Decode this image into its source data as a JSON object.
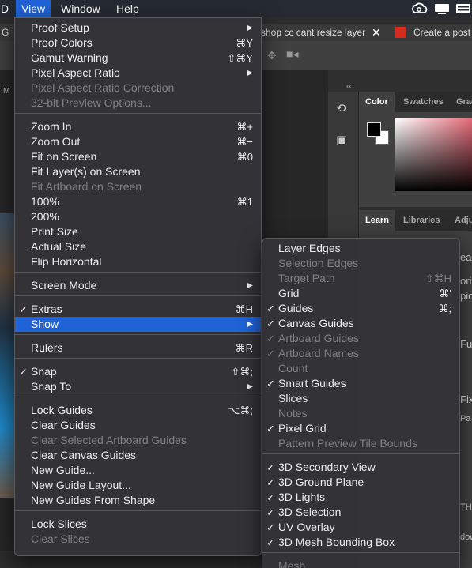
{
  "menubar": {
    "items": [
      {
        "label": "D"
      },
      {
        "label": "View"
      },
      {
        "label": "Window"
      },
      {
        "label": "Help"
      }
    ],
    "tray_icons": [
      "creative-cloud-icon",
      "screen-icon",
      "list-icon",
      "menu-icon"
    ]
  },
  "browser_tabs": [
    {
      "label": "G"
    },
    {
      "label": "shop cc cant resize layer"
    },
    {
      "label": "Create a post"
    }
  ],
  "side_panel": {
    "collapse_glyph": "‹‹",
    "top_tabs": [
      "Color",
      "Swatches",
      "Grad"
    ],
    "lower_tabs": [
      "Learn",
      "Libraries",
      "Adju"
    ],
    "right_fragments": [
      "ea",
      "ori",
      "pic",
      "Fu",
      "Fix",
      "Pa",
      "TH",
      "dow"
    ]
  },
  "doc_fragments": {
    "left_letters": [
      "M"
    ]
  },
  "view_menu": {
    "items": [
      {
        "type": "item",
        "label": "Proof Setup",
        "submenu": true
      },
      {
        "type": "item",
        "label": "Proof Colors",
        "shortcut": "⌘Y"
      },
      {
        "type": "item",
        "label": "Gamut Warning",
        "shortcut": "⇧⌘Y"
      },
      {
        "type": "item",
        "label": "Pixel Aspect Ratio",
        "submenu": true
      },
      {
        "type": "item",
        "label": "Pixel Aspect Ratio Correction",
        "disabled": true
      },
      {
        "type": "item",
        "label": "32-bit Preview Options...",
        "disabled": true
      },
      {
        "type": "separator"
      },
      {
        "type": "item",
        "label": "Zoom In",
        "shortcut": "⌘+"
      },
      {
        "type": "item",
        "label": "Zoom Out",
        "shortcut": "⌘−"
      },
      {
        "type": "item",
        "label": "Fit on Screen",
        "shortcut": "⌘0"
      },
      {
        "type": "item",
        "label": "Fit Layer(s) on Screen"
      },
      {
        "type": "item",
        "label": "Fit Artboard on Screen",
        "disabled": true
      },
      {
        "type": "item",
        "label": "100%",
        "shortcut": "⌘1"
      },
      {
        "type": "item",
        "label": "200%"
      },
      {
        "type": "item",
        "label": "Print Size"
      },
      {
        "type": "item",
        "label": "Actual Size"
      },
      {
        "type": "item",
        "label": "Flip Horizontal"
      },
      {
        "type": "separator"
      },
      {
        "type": "item",
        "label": "Screen Mode",
        "submenu": true
      },
      {
        "type": "separator"
      },
      {
        "type": "item",
        "label": "Extras",
        "shortcut": "⌘H",
        "checked": true
      },
      {
        "type": "item",
        "label": "Show",
        "submenu": true,
        "highlighted": true
      },
      {
        "type": "separator"
      },
      {
        "type": "item",
        "label": "Rulers",
        "shortcut": "⌘R"
      },
      {
        "type": "separator"
      },
      {
        "type": "item",
        "label": "Snap",
        "shortcut": "⇧⌘;",
        "checked": true
      },
      {
        "type": "item",
        "label": "Snap To",
        "submenu": true
      },
      {
        "type": "separator"
      },
      {
        "type": "item",
        "label": "Lock Guides",
        "shortcut": "⌥⌘;"
      },
      {
        "type": "item",
        "label": "Clear Guides"
      },
      {
        "type": "item",
        "label": "Clear Selected Artboard Guides",
        "disabled": true
      },
      {
        "type": "item",
        "label": "Clear Canvas Guides"
      },
      {
        "type": "item",
        "label": "New Guide..."
      },
      {
        "type": "item",
        "label": "New Guide Layout..."
      },
      {
        "type": "item",
        "label": "New Guides From Shape"
      },
      {
        "type": "separator"
      },
      {
        "type": "item",
        "label": "Lock Slices"
      },
      {
        "type": "item",
        "label": "Clear Slices",
        "disabled": true
      }
    ]
  },
  "show_menu": {
    "items": [
      {
        "type": "item",
        "label": "Layer Edges"
      },
      {
        "type": "item",
        "label": "Selection Edges",
        "disabled": true
      },
      {
        "type": "item",
        "label": "Target Path",
        "shortcut": "⇧⌘H",
        "disabled": true
      },
      {
        "type": "item",
        "label": "Grid",
        "shortcut": "⌘'"
      },
      {
        "type": "item",
        "label": "Guides",
        "shortcut": "⌘;",
        "checked": true
      },
      {
        "type": "item",
        "label": "Canvas Guides",
        "checked": true
      },
      {
        "type": "item",
        "label": "Artboard Guides",
        "checked": true,
        "disabled": true
      },
      {
        "type": "item",
        "label": "Artboard Names",
        "checked": true,
        "disabled": true
      },
      {
        "type": "item",
        "label": "Count",
        "disabled": true
      },
      {
        "type": "item",
        "label": "Smart Guides",
        "checked": true
      },
      {
        "type": "item",
        "label": "Slices"
      },
      {
        "type": "item",
        "label": "Notes",
        "disabled": true
      },
      {
        "type": "item",
        "label": "Pixel Grid",
        "checked": true
      },
      {
        "type": "item",
        "label": "Pattern Preview Tile Bounds",
        "disabled": true
      },
      {
        "type": "separator"
      },
      {
        "type": "item",
        "label": "3D Secondary View",
        "checked": true
      },
      {
        "type": "item",
        "label": "3D Ground Plane",
        "checked": true
      },
      {
        "type": "item",
        "label": "3D Lights",
        "checked": true
      },
      {
        "type": "item",
        "label": "3D Selection",
        "checked": true
      },
      {
        "type": "item",
        "label": "UV Overlay",
        "checked": true
      },
      {
        "type": "item",
        "label": "3D Mesh Bounding Box",
        "checked": true
      },
      {
        "type": "separator"
      },
      {
        "type": "item",
        "label": "Mesh",
        "disabled": true
      }
    ]
  },
  "glyphs": {
    "check": "✓",
    "submenu_arrow": "▶"
  },
  "colors": {
    "highlight": "#1f63d6",
    "menubar": "#252a33",
    "menu_bg": "#343438",
    "disabled_text": "#808084"
  }
}
